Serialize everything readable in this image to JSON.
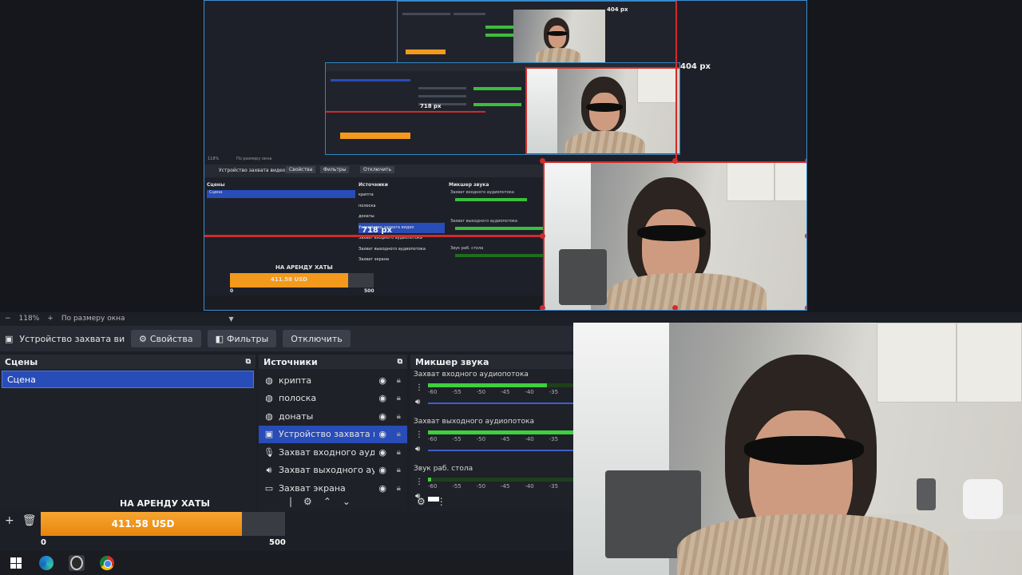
{
  "preview": {
    "nested_labels": {
      "width_label": "404 px",
      "left_label": "718 px",
      "small_label": "404 px",
      "tiny_label": "718 px"
    },
    "mini": {
      "zoom": "118%",
      "fit": "По размеру окна",
      "source_name": "Устройство захвата видео",
      "props": "Свойства",
      "filters": "Фильтры",
      "disable": "Отключить",
      "scenes": "Сцены",
      "scene": "Сцена",
      "sources": "Источники",
      "mixer": "Микшер звука",
      "src": [
        "крипта",
        "полоска",
        "донаты",
        "Устройство захвата видео",
        "Захват входного аудиопотока",
        "Захват выходного аудиопотока",
        "Захват экрана"
      ],
      "ch": [
        "Захват входного аудиопотока",
        "Захват выходного аудиопотока",
        "Звук раб. стола"
      ],
      "donate_title": "НА АРЕНДУ ХАТЫ",
      "donate_val": "411.58 USD",
      "donate_min": "0",
      "donate_max": "500"
    }
  },
  "zoombar": {
    "minus": "−",
    "zoom": "118%",
    "plus": "+",
    "fit": "По размеру окна"
  },
  "toolbar": {
    "source_name": "Устройство захвата видео",
    "properties": "Свойства",
    "filters": "Фильтры",
    "disable": "Отключить"
  },
  "scenes": {
    "title": "Сцены",
    "items": [
      "Сцена"
    ]
  },
  "sources": {
    "title": "Источники",
    "items": [
      {
        "label": "крипта",
        "icon": "globe-icon"
      },
      {
        "label": "полоска",
        "icon": "globe-icon"
      },
      {
        "label": "донаты",
        "icon": "globe-icon"
      },
      {
        "label": "Устройство захвата видео",
        "icon": "camera-icon"
      },
      {
        "label": "Захват входного аудиопотока",
        "icon": "microphone-icon"
      },
      {
        "label": "Захват выходного аудиопотока",
        "icon": "speaker-icon"
      },
      {
        "label": "Захват экрана",
        "icon": "monitor-icon"
      }
    ]
  },
  "mixer": {
    "title": "Микшер звука",
    "channels": [
      {
        "name": "Захват входного аудиопотока",
        "level": 0.82
      },
      {
        "name": "Захват выходного аудиопотока",
        "level": 1.0
      },
      {
        "name": "Звук раб. стола",
        "level": 0.02
      }
    ],
    "ticks": [
      "-60",
      "-55",
      "-50",
      "-45",
      "-40",
      "-35"
    ]
  },
  "donation": {
    "title": "НА АРЕНДУ ХАТЫ",
    "value": "411.58 USD",
    "min": "0",
    "max": "500",
    "progress": 0.823
  },
  "colors": {
    "accent_blue": "#284cb8",
    "selection_red": "#d22b2b",
    "meter_green": "#3fcf3f",
    "donate_orange": "#f39a1c"
  }
}
